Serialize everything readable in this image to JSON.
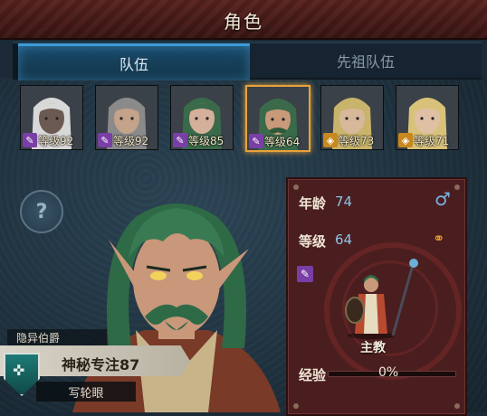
{
  "title": "角色",
  "tabs": [
    {
      "label": "队伍",
      "active": true
    },
    {
      "label": "先祖队伍",
      "active": false
    }
  ],
  "party": [
    {
      "level_label": "等级92",
      "badge": "staff-icon",
      "badge_color": "#7a3fa6",
      "hair": "#d8d8d8",
      "skin": "#6b5a52",
      "selected": false
    },
    {
      "level_label": "等级92",
      "badge": "staff-icon",
      "badge_color": "#7a3fa6",
      "hair": "#8a8a8a",
      "skin": "#c4a38a",
      "selected": false
    },
    {
      "level_label": "等级85",
      "badge": "staff-icon",
      "badge_color": "#7a3fa6",
      "hair": "#3a6a4a",
      "skin": "#d4b09a",
      "selected": false
    },
    {
      "level_label": "等级64",
      "badge": "staff-icon",
      "badge_color": "#7a3fa6",
      "hair": "#3a6a4a",
      "skin": "#c89a7a",
      "selected": true
    },
    {
      "level_label": "等级73",
      "badge": "shield-icon",
      "badge_color": "#c8881e",
      "hair": "#c8b46a",
      "skin": "#d8b89a",
      "selected": false
    },
    {
      "level_label": "等级71",
      "badge": "shield-icon",
      "badge_color": "#c8881e",
      "hair": "#d8c27a",
      "skin": "#e0c0a4",
      "selected": false
    }
  ],
  "info": {
    "age_label": "年龄",
    "age_value": "74",
    "gender_icon": "male-icon",
    "level_label": "等级",
    "level_value": "64",
    "relationship_icon": "rings-icon",
    "class_badge_icon": "staff-icon",
    "class_name": "主教",
    "xp_label": "经验",
    "xp_value": "0%",
    "xp_progress": 0
  },
  "title_rank": "隐异伯爵",
  "trait": {
    "name": "神秘专注87",
    "sub": "写轮眼"
  },
  "help_icon": "question-icon",
  "colors": {
    "selected_border": "#e8a23a",
    "tab_active": "#3d9bd8",
    "info_panel": "#4a1e1f"
  }
}
